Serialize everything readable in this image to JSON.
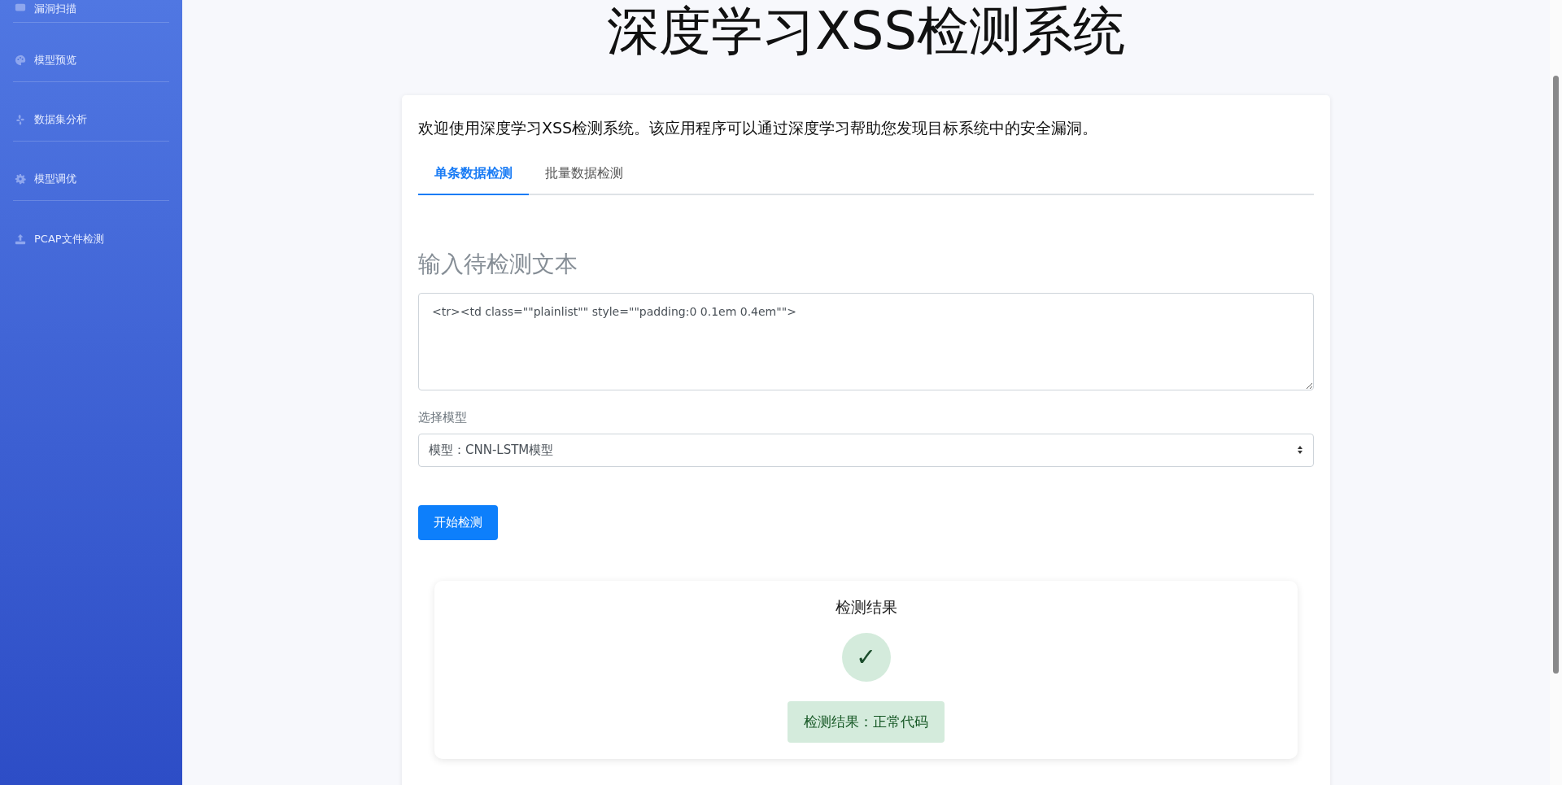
{
  "sidebar": {
    "items": [
      {
        "label": "漏洞扫描"
      },
      {
        "label": "模型预览"
      },
      {
        "label": "数据集分析"
      },
      {
        "label": "模型调优"
      },
      {
        "label": "PCAP文件检测"
      }
    ]
  },
  "page_title": "深度学习XSS检测系统",
  "intro": "欢迎使用深度学习XSS检测系统。该应用程序可以通过深度学习帮助您发现目标系统中的安全漏洞。",
  "tabs": [
    {
      "label": "单条数据检测",
      "selected": true
    },
    {
      "label": "批量数据检测",
      "selected": false
    }
  ],
  "section_heading": "输入待检测文本",
  "input_text": {
    "value": "<tr><td class=\"\"plainlist\"\" style=\"\"padding:0 0.1em 0.4em\"\">"
  },
  "model_select": {
    "label": "选择模型",
    "value": "模型：CNN-LSTM模型"
  },
  "start_button": "开始检测",
  "result": {
    "title": "检测结果",
    "symbol": "✓",
    "message": "检测结果：正常代码",
    "safe": true
  }
}
